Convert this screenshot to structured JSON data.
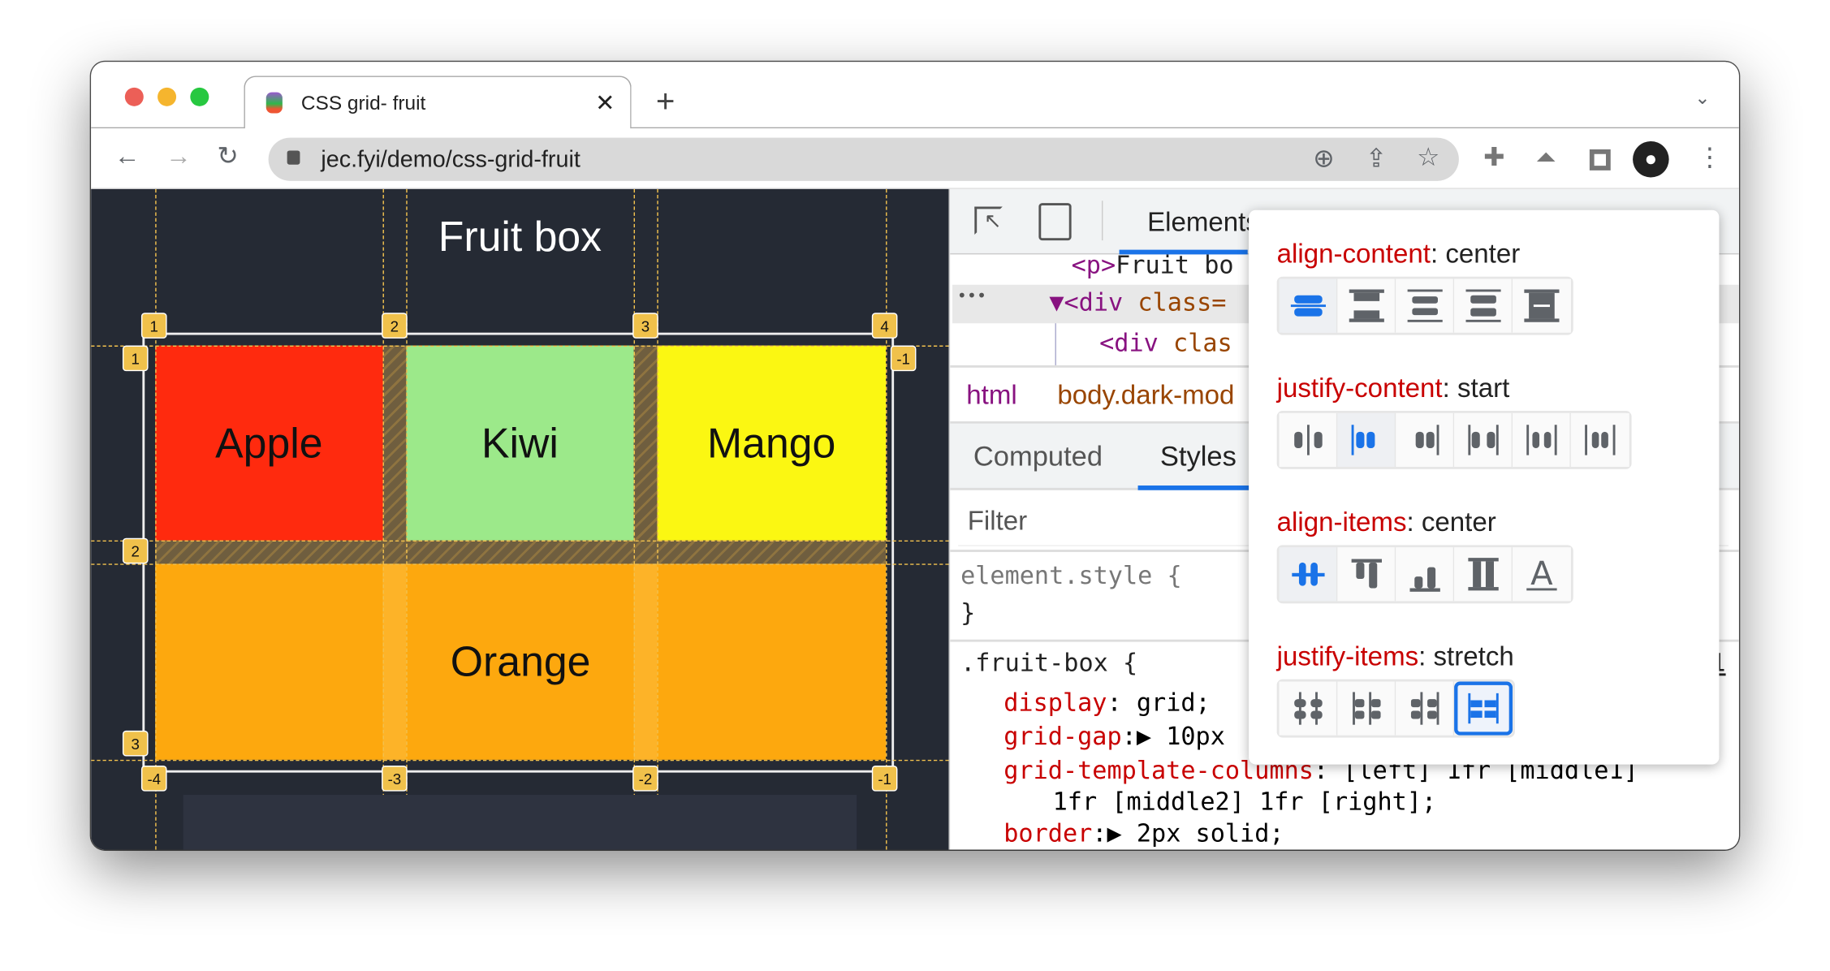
{
  "browser": {
    "tab_title": "CSS grid- fruit",
    "url": "jec.fyi/demo/css-grid-fruit",
    "traffic_colors": [
      "#ec5f57",
      "#f5b52e",
      "#27c840"
    ]
  },
  "page": {
    "title": "Fruit box",
    "items": [
      {
        "label": "Apple",
        "color": "#ff2a0e"
      },
      {
        "label": "Kiwi",
        "color": "#9ce98a"
      },
      {
        "label": "Mango",
        "color": "#fbf712"
      },
      {
        "label": "Orange",
        "color": "#fda80e"
      }
    ],
    "col_labels_top": [
      "1",
      "2",
      "3",
      "4"
    ],
    "row_labels_left": [
      "1",
      "2",
      "3"
    ],
    "row_label_right": "-1",
    "col_labels_bottom": [
      "-4",
      "-3",
      "-2",
      "-1"
    ]
  },
  "devtools": {
    "panel_tab": "Elements",
    "dom": {
      "line1_tag": "<p>",
      "line1_text": "Fruit bo",
      "ellipsis": "•••",
      "line2_tag": "▼<div",
      "line2_attr": "class=",
      "line3_tag": "<div",
      "line3_attr": "clas"
    },
    "breadcrumb": [
      "html",
      "body.dark-mod"
    ],
    "tabs": [
      "Computed",
      "Styles"
    ],
    "filter_placeholder": "Filter",
    "element_style": "element.style {",
    "close_brace": "}",
    "rule_selector": ".fruit-box {",
    "rule_source": "1",
    "decls": [
      {
        "prop": "display",
        "value": "grid;"
      },
      {
        "prop": "grid-gap",
        "value": "▶ 10px"
      },
      {
        "prop": "grid-template-columns",
        "value": "[left] 1fr [middle1]"
      },
      {
        "prop": "",
        "value": "1fr [middle2] 1fr [right];"
      },
      {
        "prop": "border",
        "value": "▶ 2px solid;"
      }
    ]
  },
  "popup": {
    "sections": [
      {
        "property": "align-content",
        "value": "center",
        "options": 5,
        "selected": 0
      },
      {
        "property": "justify-content",
        "value": "start",
        "options": 6,
        "selected": 1
      },
      {
        "property": "align-items",
        "value": "center",
        "options": 5,
        "selected": 0
      },
      {
        "property": "justify-items",
        "value": "stretch",
        "options": 4,
        "selected": 3
      }
    ],
    "accent": "#1a73e8"
  }
}
